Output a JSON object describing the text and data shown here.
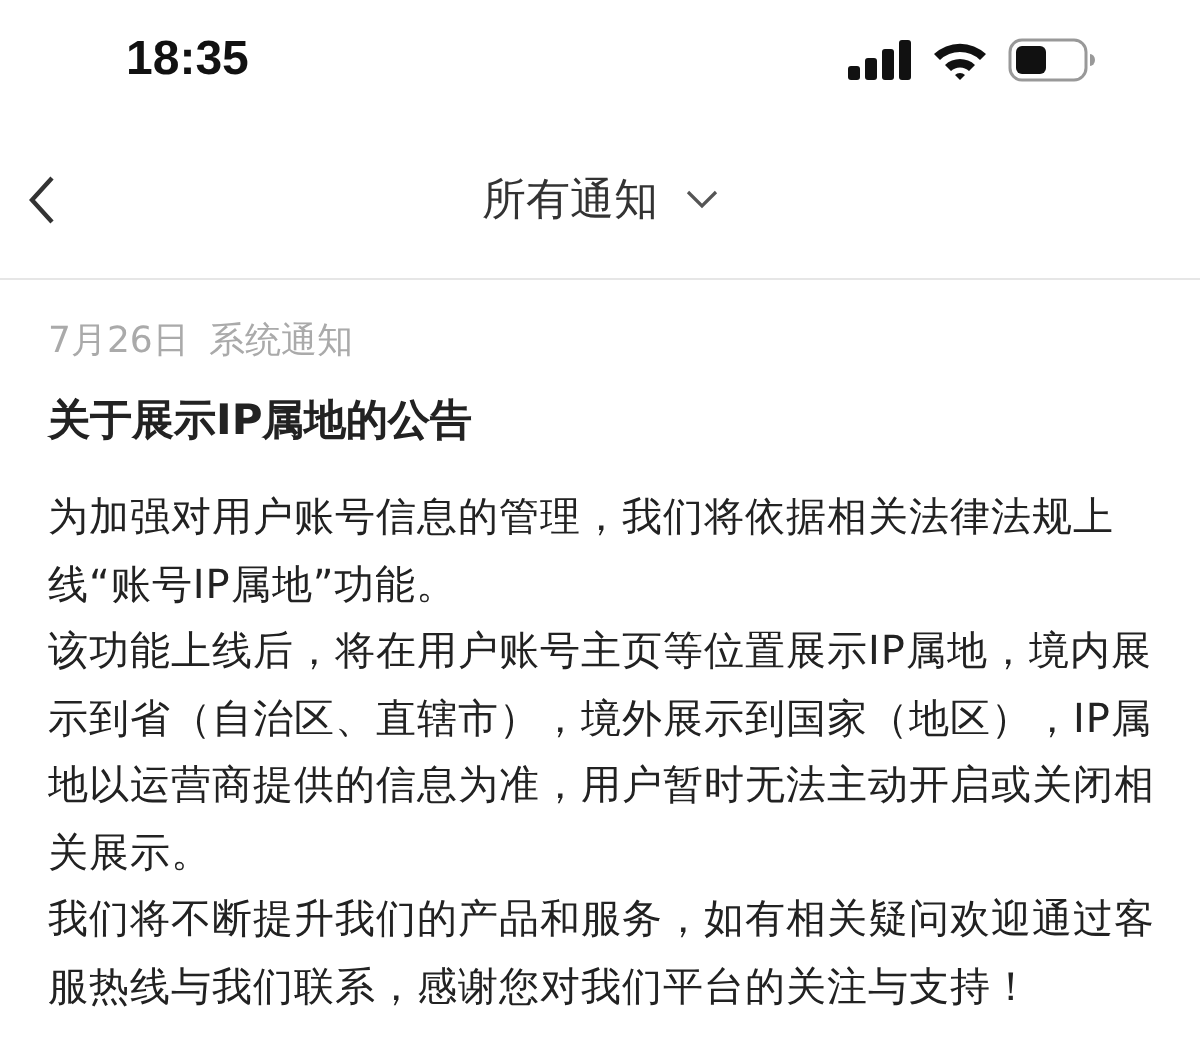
{
  "status_bar": {
    "time": "18:35"
  },
  "nav": {
    "title": "所有通知"
  },
  "notice": {
    "date": "7月26日",
    "category": "系统通知",
    "title": "关于展示IP属地的公告",
    "paragraphs": [
      "为加强对用户账号信息的管理，我们将依据相关法律法规上线“账号IP属地”功能。",
      "该功能上线后，将在用户账号主页等位置展示IP属地，境内展示到省（自治区、直辖市），境外展示到国家（地区），IP属地以运营商提供的信息为准，用户暂时无法主动开启或关闭相关展示。",
      "我们将不断提升我们的产品和服务，如有相关疑问欢迎通过客服热线与我们联系，感谢您对我们平台的关注与支持！"
    ]
  }
}
